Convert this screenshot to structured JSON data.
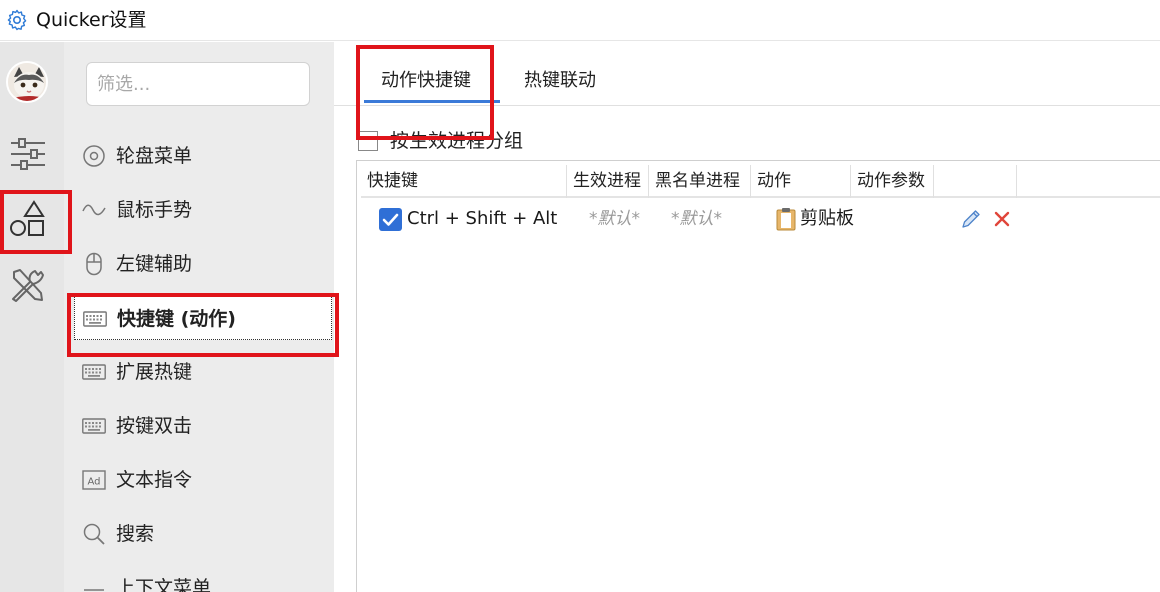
{
  "window": {
    "title": "Quicker设置",
    "icon": "gear-icon"
  },
  "rail": {
    "items": [
      {
        "name": "avatar"
      },
      {
        "name": "sliders-icon"
      },
      {
        "name": "shapes-icon",
        "selected": true
      },
      {
        "name": "tools-icon"
      }
    ]
  },
  "sidebar": {
    "filter_placeholder": "筛选...",
    "items": [
      {
        "label": "轮盘菜单",
        "icon": "radial-menu-icon"
      },
      {
        "label": "鼠标手势",
        "icon": "wave-icon"
      },
      {
        "label": "左键辅助",
        "icon": "mouse-icon"
      },
      {
        "label": "快捷键 (动作)",
        "icon": "keyboard-icon",
        "selected": true
      },
      {
        "label": "扩展热键",
        "icon": "keyboard-icon"
      },
      {
        "label": "按键双击",
        "icon": "keyboard-icon"
      },
      {
        "label": "文本指令",
        "icon": "ad-icon"
      },
      {
        "label": "搜索",
        "icon": "search-icon"
      },
      {
        "label": "上下文菜单",
        "icon": "menu-icon"
      }
    ]
  },
  "main": {
    "tabs": [
      {
        "label": "动作快捷键",
        "active": true
      },
      {
        "label": "热键联动",
        "active": false
      }
    ],
    "group_by_process": {
      "label": "按生效进程分组",
      "checked": false
    },
    "table": {
      "columns": [
        "快捷键",
        "生效进程",
        "黑名单进程",
        "动作",
        "动作参数"
      ],
      "rows": [
        {
          "checked": true,
          "hotkey": "Ctrl + Shift + Alt +",
          "process": "*默认*",
          "blacklist": "*默认*",
          "action": "剪贴板",
          "action_icon": "clipboard-icon",
          "params": ""
        }
      ]
    }
  },
  "colors": {
    "accent": "#3b7ad8",
    "highlight": "#e0141a",
    "delete": "#e0453a"
  }
}
